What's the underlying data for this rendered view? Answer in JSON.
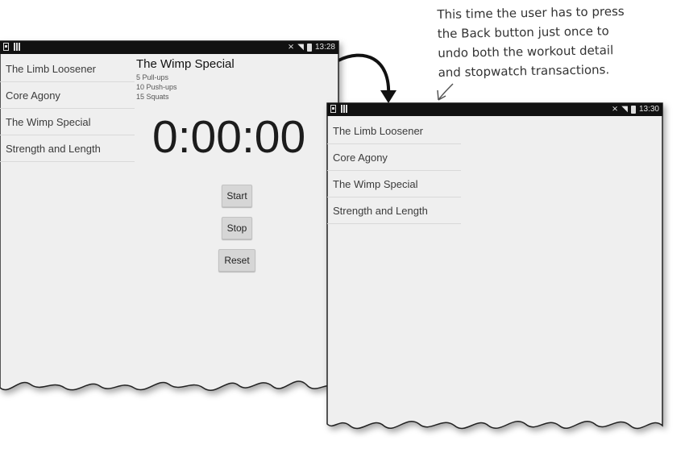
{
  "screen_before": {
    "status": {
      "time": "13:28"
    },
    "workouts": [
      "The Limb Loosener",
      "Core Agony",
      "The Wimp Special",
      "Strength and Length"
    ],
    "detail": {
      "title": "The Wimp Special",
      "lines": [
        "5 Pull-ups",
        "10 Push-ups",
        "15 Squats"
      ]
    },
    "stopwatch": {
      "time": "0:00:00",
      "start_label": "Start",
      "stop_label": "Stop",
      "reset_label": "Reset"
    }
  },
  "screen_after": {
    "status": {
      "time": "13:30"
    },
    "workouts": [
      "The Limb Loosener",
      "Core Agony",
      "The Wimp Special",
      "Strength and Length"
    ]
  },
  "annotation": {
    "lines": [
      "This time the user has to press",
      "the Back button just once to",
      "undo both the workout detail",
      "and stopwatch transactions."
    ]
  },
  "icons": {
    "status_left": [
      "phone-icon",
      "signal-bars-icon"
    ],
    "status_right": [
      "mute-icon",
      "wifi-icon",
      "battery-icon"
    ],
    "arrow": "curved-arrow-icon"
  }
}
